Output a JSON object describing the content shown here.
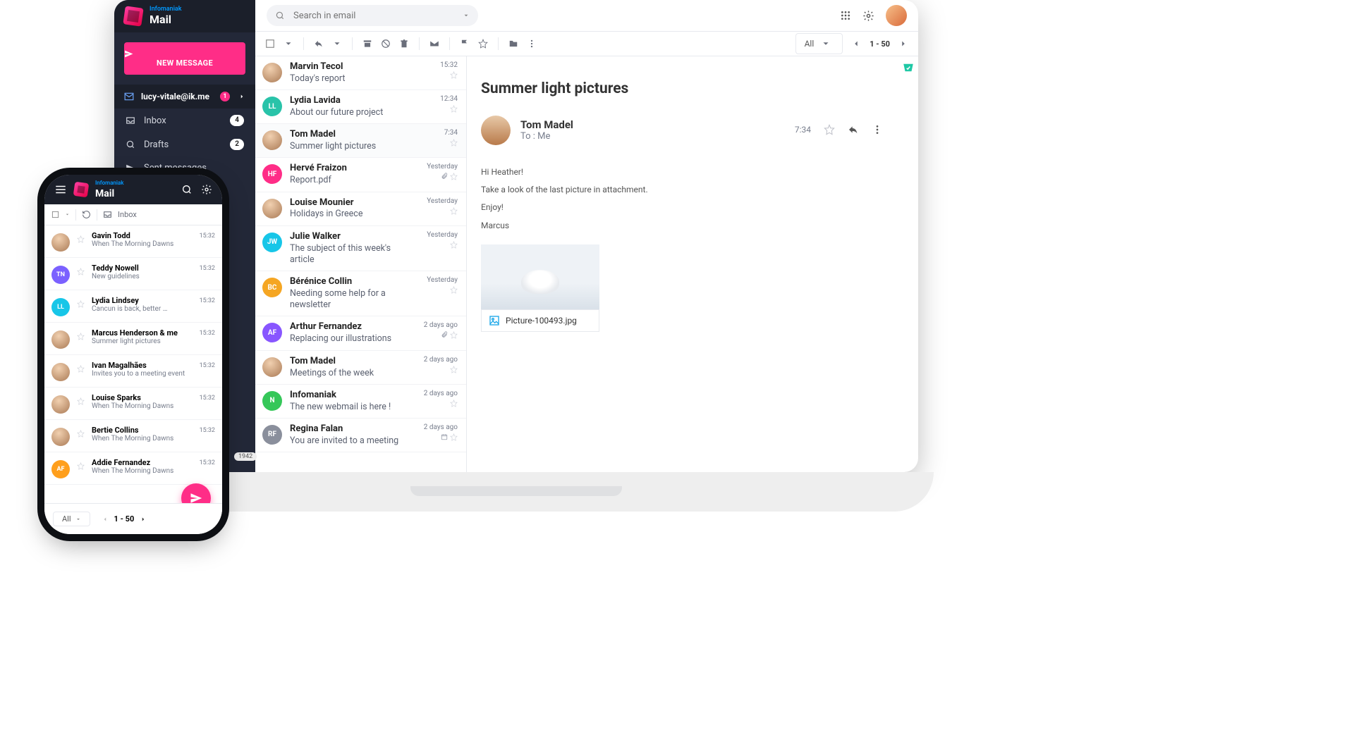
{
  "brand_small": "Infomaniak",
  "brand": "Mail",
  "search_placeholder": "Search in email",
  "new_message": "NEW MESSAGE",
  "account": "lucy-vitale@ik.me",
  "account_badge": "1",
  "nav": {
    "inbox": "Inbox",
    "inbox_count": "4",
    "drafts": "Drafts",
    "drafts_count": "2",
    "sent": "Sent messages"
  },
  "bottom_count": "1942",
  "filter": "All",
  "pager": "1 - 50",
  "list": [
    {
      "name": "Marvin Tecol",
      "subject": "Today's report",
      "time": "15:32",
      "avatar": "photo"
    },
    {
      "name": "Lydia Lavida",
      "subject": "About our future project",
      "time": "12:34",
      "avatar": "LL",
      "color": "#29c3a9"
    },
    {
      "name": "Tom Madel",
      "subject": "Summer light pictures",
      "time": "7:34",
      "avatar": "photo",
      "selected": true
    },
    {
      "name": "Hervé Fraizon",
      "subject": "Report.pdf",
      "time": "Yesterday",
      "avatar": "HF",
      "color": "#ff2d87",
      "attach": true
    },
    {
      "name": "Louise Mounier",
      "subject": "Holidays in Greece",
      "time": "Yesterday",
      "avatar": "photo"
    },
    {
      "name": "Julie Walker",
      "subject": "The subject of this week's article",
      "time": "Yesterday",
      "avatar": "JW",
      "color": "#17c6e8"
    },
    {
      "name": "Bérénice Collin",
      "subject": "Needing some help for a newsletter",
      "time": "Yesterday",
      "avatar": "BC",
      "color": "#f5a623"
    },
    {
      "name": "Arthur Fernandez",
      "subject": "Replacing our illustrations",
      "time": "2 days ago",
      "avatar": "AF",
      "color": "#8856ff",
      "attach": true
    },
    {
      "name": "Tom Madel",
      "subject": "Meetings of the week",
      "time": "2 days ago",
      "avatar": "photo"
    },
    {
      "name": "Infomaniak",
      "subject": "The new webmail is here !",
      "time": "2 days ago",
      "avatar": "N",
      "color": "#35c759"
    },
    {
      "name": "Regina Falan",
      "subject": "You are invited to a meeting",
      "time": "2 days ago",
      "avatar": "RF",
      "color": "#8a8f9c",
      "cal": true
    }
  ],
  "msg": {
    "subject": "Summer light pictures",
    "from": "Tom Madel",
    "to": "To : Me",
    "time": "7:34",
    "lines": [
      "Hi Heather!",
      "Take a look of the last picture in attachment.",
      "Enjoy!",
      "Marcus"
    ],
    "attachment": "Picture-100493.jpg"
  },
  "phone": {
    "folder": "Inbox",
    "list": [
      {
        "name": "Gavin Todd",
        "subject": "When The Morning Dawns",
        "time": "15:32",
        "avatar": "photo"
      },
      {
        "name": "Teddy Nowell",
        "subject": "New guidelines",
        "time": "15:32",
        "avatar": "TN",
        "color": "#7b61ff"
      },
      {
        "name": "Lydia Lindsey",
        "subject": "Cancun is back, better …",
        "time": "15:32",
        "avatar": "LL",
        "color": "#17c6e8"
      },
      {
        "name": "Marcus Henderson & me",
        "subject": "Summer light pictures",
        "time": "15:32",
        "avatar": "photo"
      },
      {
        "name": "Ivan Magalhães",
        "subject": "Invites you to a meeting event",
        "time": "15:32",
        "avatar": "photo"
      },
      {
        "name": "Louise Sparks",
        "subject": "When The Morning Dawns",
        "time": "15:32",
        "avatar": "photo"
      },
      {
        "name": "Bertie Collins",
        "subject": "When The Morning Dawns",
        "time": "15:32",
        "avatar": "photo"
      },
      {
        "name": "Addie Fernandez",
        "subject": "When The Morning Dawns",
        "time": "15:32",
        "avatar": "AF",
        "color": "#ff9f1c"
      }
    ],
    "filter": "All",
    "pager": "1 - 50"
  }
}
